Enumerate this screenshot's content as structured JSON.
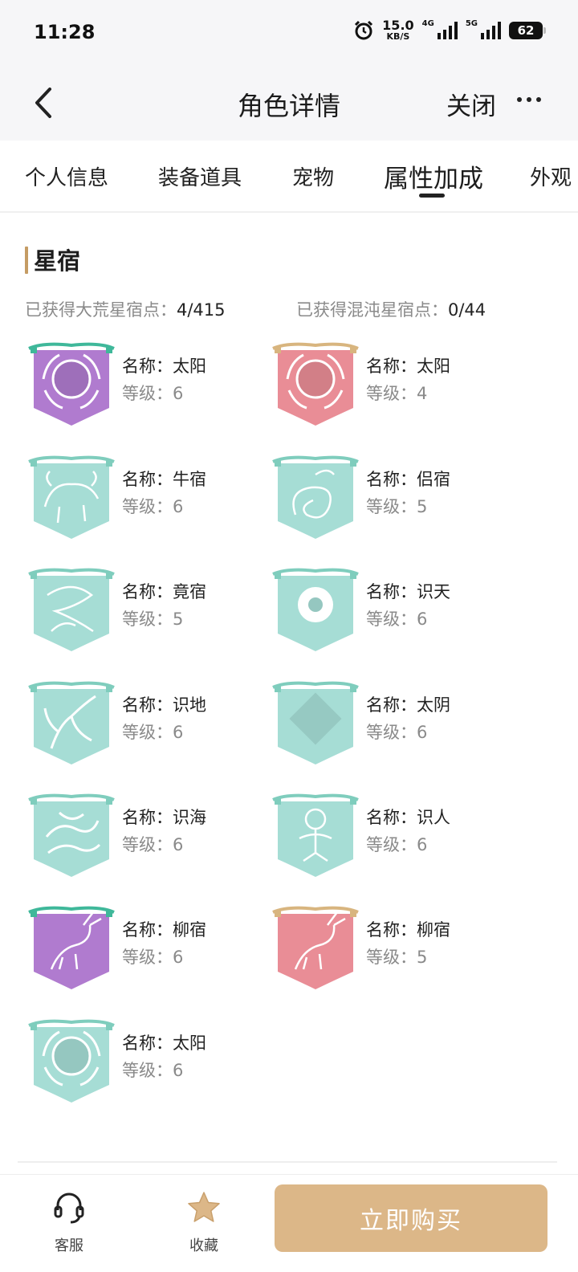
{
  "status_bar": {
    "time": "11:28",
    "net_speed_value": "15.0",
    "net_speed_unit": "KB/S",
    "signal1_label": "4G",
    "signal2_label": "5G",
    "battery": "62"
  },
  "nav": {
    "title": "角色详情",
    "close_label": "关闭"
  },
  "tabs": [
    {
      "label": "个人信息"
    },
    {
      "label": "装备道具"
    },
    {
      "label": "宠物"
    },
    {
      "label": "属性加成",
      "active": true
    },
    {
      "label": "外观"
    }
  ],
  "section": {
    "title": "星宿",
    "stat1_label": "已获得大荒星宿点：",
    "stat1_value": "4/415",
    "stat2_label": "已获得混沌星宿点：",
    "stat2_value": "0/44",
    "name_label": "名称：",
    "level_label": "等级："
  },
  "items": [
    {
      "name": "太阳",
      "level": "6",
      "color": "#b07bcf",
      "icon": "sun-emblem-icon"
    },
    {
      "name": "太阳",
      "level": "4",
      "color": "#e98d96",
      "icon": "sun-emblem-icon"
    },
    {
      "name": "牛宿",
      "level": "6",
      "color": "#a6ddd5",
      "icon": "ox-emblem-icon"
    },
    {
      "name": "侣宿",
      "level": "5",
      "color": "#a6ddd5",
      "icon": "serpent-emblem-icon"
    },
    {
      "name": "竟宿",
      "level": "5",
      "color": "#a6ddd5",
      "icon": "dragon-emblem-icon"
    },
    {
      "name": "识天",
      "level": "6",
      "color": "#a6ddd5",
      "icon": "ring-emblem-icon"
    },
    {
      "name": "识地",
      "level": "6",
      "color": "#a6ddd5",
      "icon": "tree-emblem-icon"
    },
    {
      "name": "太阴",
      "level": "6",
      "color": "#a6ddd5",
      "icon": "moon-emblem-icon"
    },
    {
      "name": "识海",
      "level": "6",
      "color": "#a6ddd5",
      "icon": "wave-emblem-icon"
    },
    {
      "name": "识人",
      "level": "6",
      "color": "#a6ddd5",
      "icon": "figure-emblem-icon"
    },
    {
      "name": "柳宿",
      "level": "6",
      "color": "#b07bcf",
      "icon": "deer-emblem-icon"
    },
    {
      "name": "柳宿",
      "level": "5",
      "color": "#e98d96",
      "icon": "deer-emblem-icon"
    },
    {
      "name": "太阳",
      "level": "6",
      "color": "#a6ddd5",
      "icon": "sun-emblem-icon"
    }
  ],
  "bottom_bar": {
    "service_label": "客服",
    "favorite_label": "收藏",
    "buy_label": "立即购买"
  },
  "colors": {
    "accent": "#dcb788",
    "section_marker": "#c59c64",
    "background_header": "#f6f6f8"
  }
}
